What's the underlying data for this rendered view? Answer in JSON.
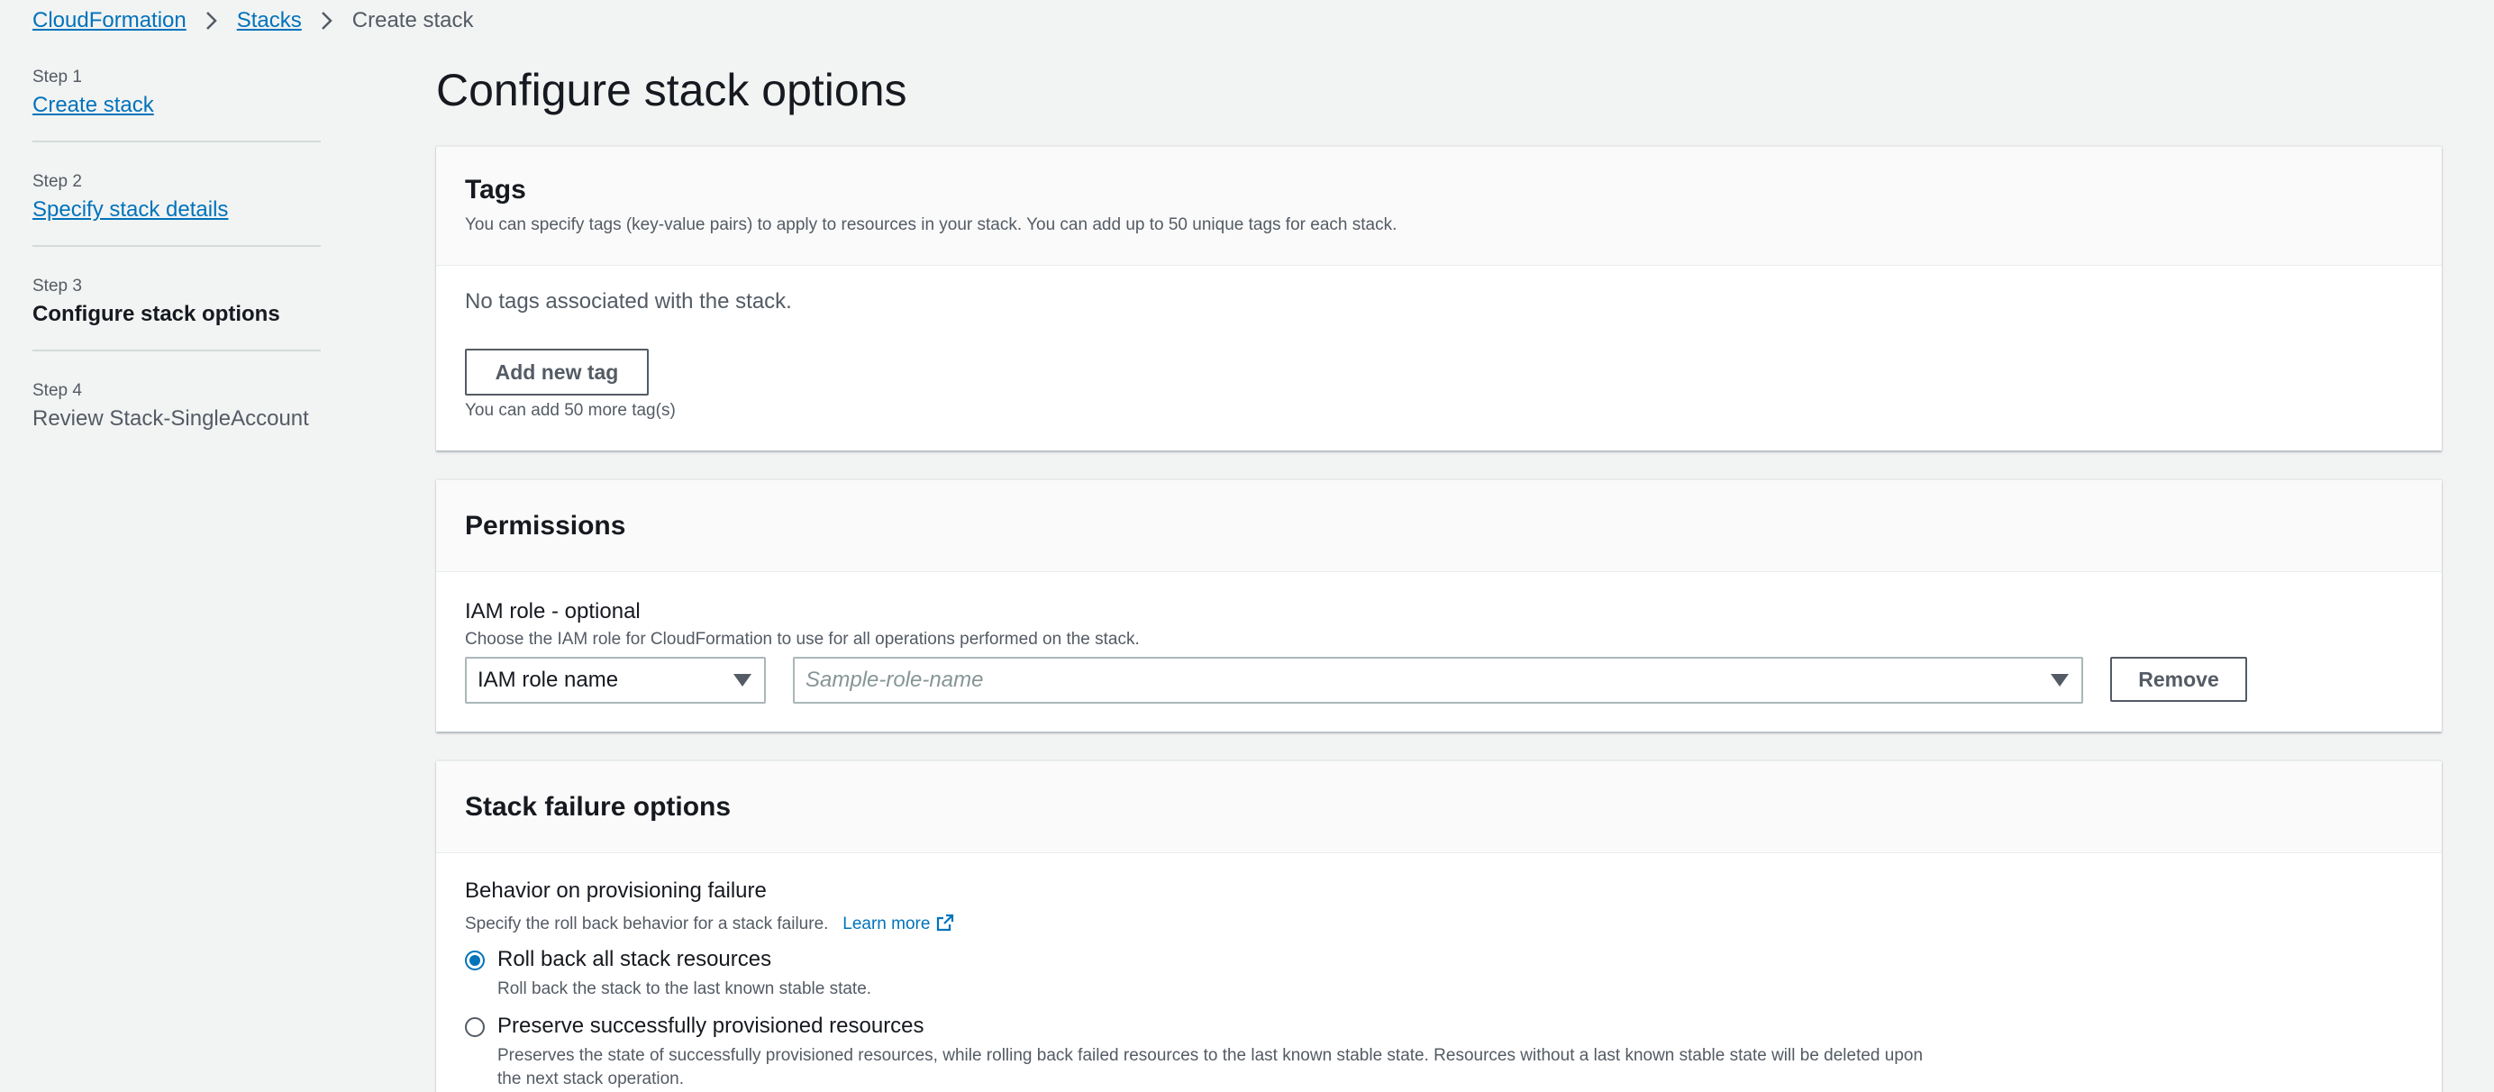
{
  "breadcrumb": {
    "items": [
      "CloudFormation",
      "Stacks"
    ],
    "current": "Create stack"
  },
  "sidebar": {
    "steps": [
      {
        "step": "Step 1",
        "label": "Create stack"
      },
      {
        "step": "Step 2",
        "label": "Specify stack details"
      },
      {
        "step": "Step 3",
        "label": "Configure stack options"
      },
      {
        "step": "Step 4",
        "label": "Review Stack-SingleAccount"
      }
    ]
  },
  "main": {
    "title": "Configure stack options"
  },
  "tags": {
    "title": "Tags",
    "description": "You can specify tags (key-value pairs) to apply to resources in your stack. You can add up to 50 unique tags for each stack.",
    "empty_text": "No tags associated with the stack.",
    "add_button": "Add new tag",
    "hint": "You can add 50 more tag(s)"
  },
  "permissions": {
    "title": "Permissions",
    "field_label": "IAM role - optional",
    "field_desc": "Choose the IAM role for CloudFormation to use for all operations performed on the stack.",
    "role_type_value": "IAM role name",
    "role_name_placeholder": "Sample-role-name",
    "remove_button": "Remove"
  },
  "failure": {
    "title": "Stack failure options",
    "field_label": "Behavior on provisioning failure",
    "field_desc": "Specify the roll back behavior for a stack failure.",
    "learn_more": "Learn more",
    "options": [
      {
        "label": "Roll back all stack resources",
        "desc": "Roll back the stack to the last known stable state.",
        "checked": true
      },
      {
        "label": "Preserve successfully provisioned resources",
        "desc": "Preserves the state of successfully provisioned resources, while rolling back failed resources to the last known stable state. Resources without a last known stable state will be deleted upon the next stack operation.",
        "checked": false
      }
    ]
  },
  "colors": {
    "link": "#0073bb",
    "background": "#f2f3f3",
    "text": "#16191f",
    "muted": "#545b64"
  },
  "icons": [
    "chevron-right-icon",
    "caret-down-icon",
    "external-link-icon"
  ]
}
